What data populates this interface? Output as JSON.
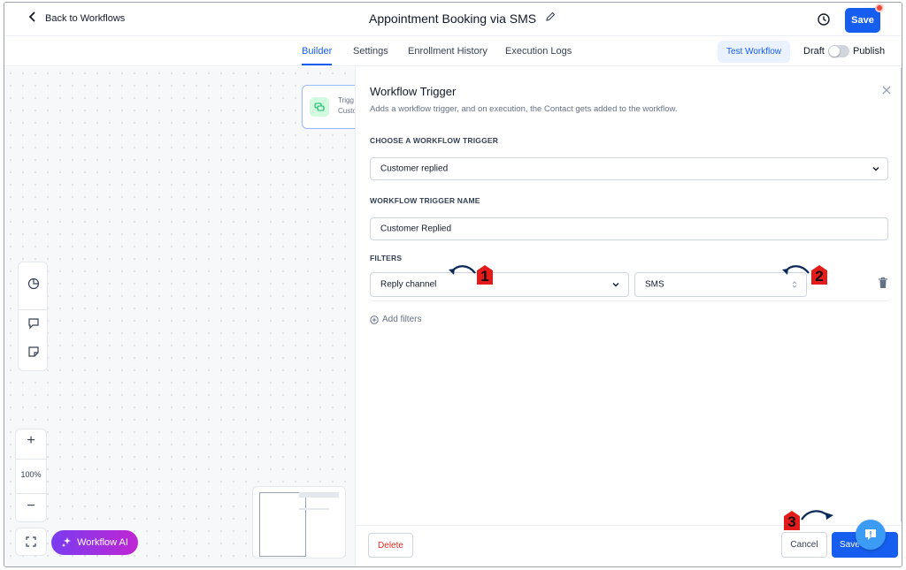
{
  "header": {
    "back_label": "Back to Workflows",
    "title": "Appointment Booking via SMS",
    "save_label": "Save"
  },
  "tabs": [
    {
      "label": "Builder",
      "active": true
    },
    {
      "label": "Settings",
      "active": false
    },
    {
      "label": "Enrollment History",
      "active": false
    },
    {
      "label": "Execution Logs",
      "active": false
    }
  ],
  "toolbar": {
    "test_label": "Test Workflow",
    "draft_label": "Draft",
    "publish_label": "Publish",
    "publish_on": false
  },
  "canvas": {
    "node": {
      "title": "Trigg",
      "subtitle": "Custo"
    },
    "zoom": "100%",
    "zoom_in": "+",
    "zoom_out": "−",
    "ai_label": "Workflow AI"
  },
  "panel": {
    "title": "Workflow Trigger",
    "description": "Adds a workflow trigger, and on execution, the Contact gets added to the workflow.",
    "choose_label": "CHOOSE A WORKFLOW TRIGGER",
    "trigger_value": "Customer replied",
    "name_label": "WORKFLOW TRIGGER NAME",
    "name_value": "Customer Replied",
    "filters_label": "FILTERS",
    "filter_field": "Reply channel",
    "filter_value": "SMS",
    "add_filters": "Add filters",
    "delete_label": "Delete",
    "cancel_label": "Cancel",
    "save_action_label": "Save"
  },
  "annotations": [
    "1",
    "2",
    "3"
  ],
  "colors": {
    "primary": "#155eef",
    "annotation": "#e41b1b",
    "ai_gradient_start": "#7a3cf0",
    "ai_gradient_end": "#c026d3",
    "delete": "#d92d20"
  }
}
